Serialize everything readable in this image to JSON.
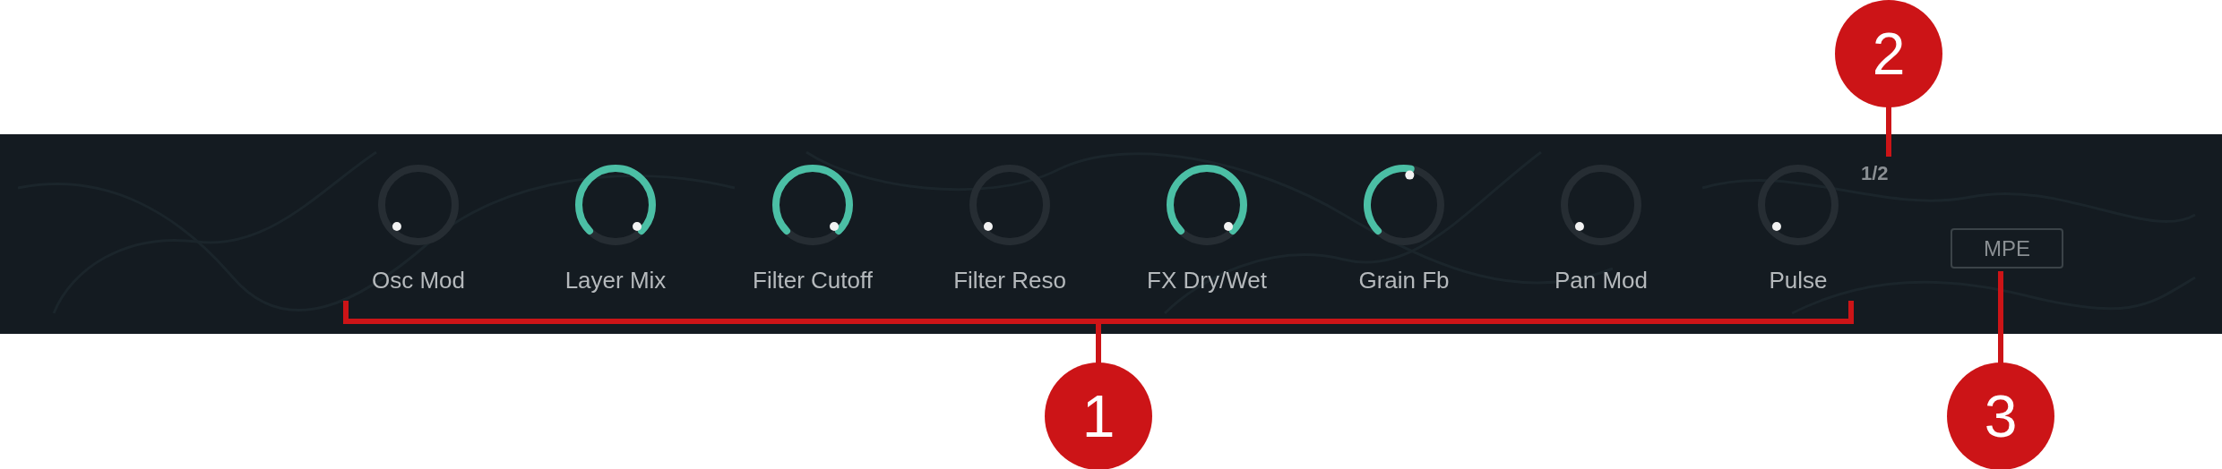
{
  "panel": {
    "knobs": [
      {
        "label": "Osc Mod"
      },
      {
        "label": "Layer Mix"
      },
      {
        "label": "Filter Cutoff"
      },
      {
        "label": "Filter Reso"
      },
      {
        "label": "FX Dry/Wet"
      },
      {
        "label": "Grain Fb"
      },
      {
        "label": "Pan Mod"
      },
      {
        "label": "Pulse"
      }
    ],
    "page_indicator": "1/2",
    "mpe_button": "MPE"
  },
  "callouts": [
    {
      "number": "1"
    },
    {
      "number": "2"
    },
    {
      "number": "3"
    }
  ]
}
